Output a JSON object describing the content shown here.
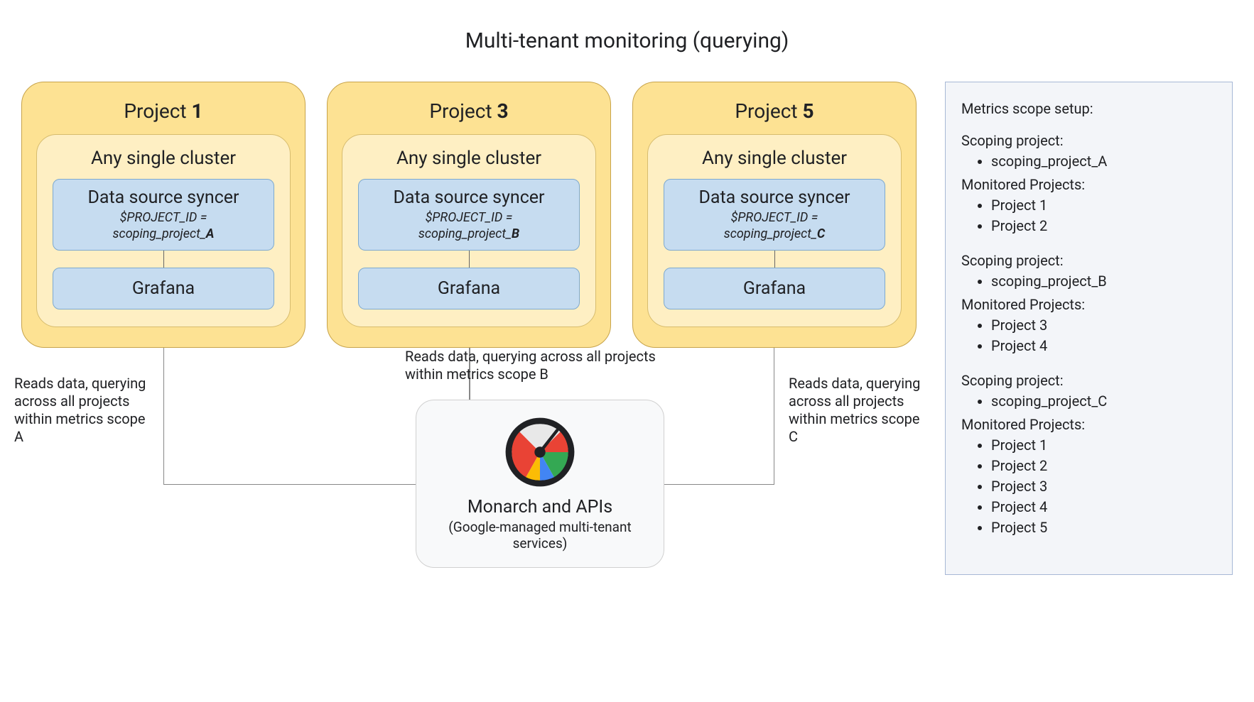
{
  "title": "Multi-tenant monitoring (querying)",
  "projects": [
    {
      "name_prefix": "Project ",
      "name_bold": "1",
      "cluster_label": "Any single cluster",
      "ds_title": "Data source syncer",
      "ds_var": "$PROJECT_ID =",
      "ds_val_prefix": "scoping_project_",
      "ds_val_bold": "A",
      "grafana": "Grafana"
    },
    {
      "name_prefix": "Project ",
      "name_bold": "3",
      "cluster_label": "Any single cluster",
      "ds_title": "Data source syncer",
      "ds_var": "$PROJECT_ID =",
      "ds_val_prefix": "scoping_project_",
      "ds_val_bold": "B",
      "grafana": "Grafana"
    },
    {
      "name_prefix": "Project ",
      "name_bold": "5",
      "cluster_label": "Any single cluster",
      "ds_title": "Data source syncer",
      "ds_var": "$PROJECT_ID =",
      "ds_val_prefix": "scoping_project_",
      "ds_val_bold": "C",
      "grafana": "Grafana"
    }
  ],
  "captions": {
    "a": "Reads data, querying across all projects within metrics scope A",
    "b": "Reads data, querying across all projects within metrics scope B",
    "c": "Reads data, querying across all projects within metrics scope C"
  },
  "monarch": {
    "title": "Monarch and APIs",
    "subtitle": "(Google-managed multi-tenant services)"
  },
  "side": {
    "heading": "Metrics scope setup:",
    "scoping_label": "Scoping project:",
    "monitored_label": "Monitored Projects:",
    "blocks": [
      {
        "scoping": "scoping_project_A",
        "monitored": [
          "Project 1",
          "Project 2"
        ]
      },
      {
        "scoping": "scoping_project_B",
        "monitored": [
          "Project 3",
          "Project 4"
        ]
      },
      {
        "scoping": "scoping_project_C",
        "monitored": [
          "Project 1",
          "Project 2",
          "Project 3",
          "Project 4",
          "Project 5"
        ]
      }
    ]
  }
}
